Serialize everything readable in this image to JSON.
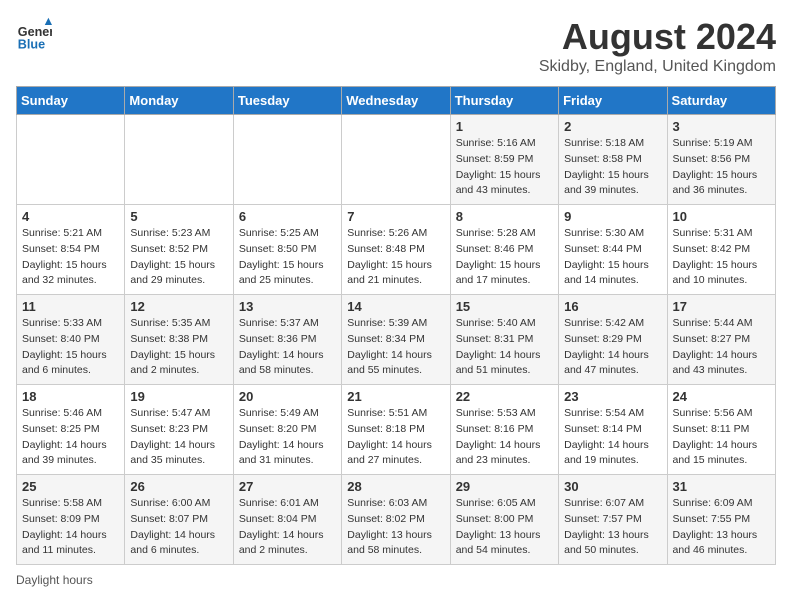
{
  "header": {
    "logo_general": "General",
    "logo_blue": "Blue",
    "month_title": "August 2024",
    "location": "Skidby, England, United Kingdom"
  },
  "days_of_week": [
    "Sunday",
    "Monday",
    "Tuesday",
    "Wednesday",
    "Thursday",
    "Friday",
    "Saturday"
  ],
  "weeks": [
    [
      {
        "day": "",
        "info": ""
      },
      {
        "day": "",
        "info": ""
      },
      {
        "day": "",
        "info": ""
      },
      {
        "day": "",
        "info": ""
      },
      {
        "day": "1",
        "info": "Sunrise: 5:16 AM\nSunset: 8:59 PM\nDaylight: 15 hours\nand 43 minutes."
      },
      {
        "day": "2",
        "info": "Sunrise: 5:18 AM\nSunset: 8:58 PM\nDaylight: 15 hours\nand 39 minutes."
      },
      {
        "day": "3",
        "info": "Sunrise: 5:19 AM\nSunset: 8:56 PM\nDaylight: 15 hours\nand 36 minutes."
      }
    ],
    [
      {
        "day": "4",
        "info": "Sunrise: 5:21 AM\nSunset: 8:54 PM\nDaylight: 15 hours\nand 32 minutes."
      },
      {
        "day": "5",
        "info": "Sunrise: 5:23 AM\nSunset: 8:52 PM\nDaylight: 15 hours\nand 29 minutes."
      },
      {
        "day": "6",
        "info": "Sunrise: 5:25 AM\nSunset: 8:50 PM\nDaylight: 15 hours\nand 25 minutes."
      },
      {
        "day": "7",
        "info": "Sunrise: 5:26 AM\nSunset: 8:48 PM\nDaylight: 15 hours\nand 21 minutes."
      },
      {
        "day": "8",
        "info": "Sunrise: 5:28 AM\nSunset: 8:46 PM\nDaylight: 15 hours\nand 17 minutes."
      },
      {
        "day": "9",
        "info": "Sunrise: 5:30 AM\nSunset: 8:44 PM\nDaylight: 15 hours\nand 14 minutes."
      },
      {
        "day": "10",
        "info": "Sunrise: 5:31 AM\nSunset: 8:42 PM\nDaylight: 15 hours\nand 10 minutes."
      }
    ],
    [
      {
        "day": "11",
        "info": "Sunrise: 5:33 AM\nSunset: 8:40 PM\nDaylight: 15 hours\nand 6 minutes."
      },
      {
        "day": "12",
        "info": "Sunrise: 5:35 AM\nSunset: 8:38 PM\nDaylight: 15 hours\nand 2 minutes."
      },
      {
        "day": "13",
        "info": "Sunrise: 5:37 AM\nSunset: 8:36 PM\nDaylight: 14 hours\nand 58 minutes."
      },
      {
        "day": "14",
        "info": "Sunrise: 5:39 AM\nSunset: 8:34 PM\nDaylight: 14 hours\nand 55 minutes."
      },
      {
        "day": "15",
        "info": "Sunrise: 5:40 AM\nSunset: 8:31 PM\nDaylight: 14 hours\nand 51 minutes."
      },
      {
        "day": "16",
        "info": "Sunrise: 5:42 AM\nSunset: 8:29 PM\nDaylight: 14 hours\nand 47 minutes."
      },
      {
        "day": "17",
        "info": "Sunrise: 5:44 AM\nSunset: 8:27 PM\nDaylight: 14 hours\nand 43 minutes."
      }
    ],
    [
      {
        "day": "18",
        "info": "Sunrise: 5:46 AM\nSunset: 8:25 PM\nDaylight: 14 hours\nand 39 minutes."
      },
      {
        "day": "19",
        "info": "Sunrise: 5:47 AM\nSunset: 8:23 PM\nDaylight: 14 hours\nand 35 minutes."
      },
      {
        "day": "20",
        "info": "Sunrise: 5:49 AM\nSunset: 8:20 PM\nDaylight: 14 hours\nand 31 minutes."
      },
      {
        "day": "21",
        "info": "Sunrise: 5:51 AM\nSunset: 8:18 PM\nDaylight: 14 hours\nand 27 minutes."
      },
      {
        "day": "22",
        "info": "Sunrise: 5:53 AM\nSunset: 8:16 PM\nDaylight: 14 hours\nand 23 minutes."
      },
      {
        "day": "23",
        "info": "Sunrise: 5:54 AM\nSunset: 8:14 PM\nDaylight: 14 hours\nand 19 minutes."
      },
      {
        "day": "24",
        "info": "Sunrise: 5:56 AM\nSunset: 8:11 PM\nDaylight: 14 hours\nand 15 minutes."
      }
    ],
    [
      {
        "day": "25",
        "info": "Sunrise: 5:58 AM\nSunset: 8:09 PM\nDaylight: 14 hours\nand 11 minutes."
      },
      {
        "day": "26",
        "info": "Sunrise: 6:00 AM\nSunset: 8:07 PM\nDaylight: 14 hours\nand 6 minutes."
      },
      {
        "day": "27",
        "info": "Sunrise: 6:01 AM\nSunset: 8:04 PM\nDaylight: 14 hours\nand 2 minutes."
      },
      {
        "day": "28",
        "info": "Sunrise: 6:03 AM\nSunset: 8:02 PM\nDaylight: 13 hours\nand 58 minutes."
      },
      {
        "day": "29",
        "info": "Sunrise: 6:05 AM\nSunset: 8:00 PM\nDaylight: 13 hours\nand 54 minutes."
      },
      {
        "day": "30",
        "info": "Sunrise: 6:07 AM\nSunset: 7:57 PM\nDaylight: 13 hours\nand 50 minutes."
      },
      {
        "day": "31",
        "info": "Sunrise: 6:09 AM\nSunset: 7:55 PM\nDaylight: 13 hours\nand 46 minutes."
      }
    ]
  ],
  "footer": {
    "label": "Daylight hours"
  }
}
